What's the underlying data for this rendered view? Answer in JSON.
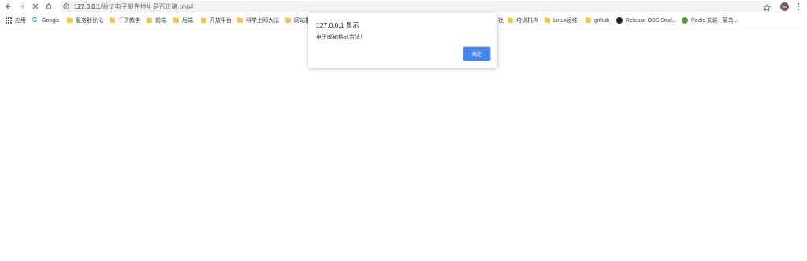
{
  "toolbar": {
    "back_icon": "back-arrow",
    "forward_icon": "forward-arrow",
    "stop_icon": "close-x",
    "home_icon": "home"
  },
  "address_bar": {
    "host": "127.0.0.1",
    "path": "/验证电子邮件地址是否正确.php#"
  },
  "profile": {
    "avatar_text": "ME",
    "avatar_color": "#7a5a4e"
  },
  "bookmarks": [
    {
      "label": "应用",
      "icon": "apps"
    },
    {
      "label": "Google",
      "icon": "google"
    },
    {
      "label": "服务器优化",
      "icon": "folder"
    },
    {
      "label": "干货教学",
      "icon": "folder"
    },
    {
      "label": "前端",
      "icon": "folder"
    },
    {
      "label": "后端",
      "icon": "folder"
    },
    {
      "label": "开放平台",
      "icon": "folder"
    },
    {
      "label": "科学上网大法",
      "icon": "folder"
    },
    {
      "label": "网站推",
      "icon": "folder"
    },
    {
      "label": "社",
      "icon": "none"
    },
    {
      "label": "培训机构",
      "icon": "folder"
    },
    {
      "label": "Linux运维",
      "icon": "folder"
    },
    {
      "label": "github",
      "icon": "folder"
    },
    {
      "label": "Release OBS Stud...",
      "icon": "github"
    },
    {
      "label": "Redis 安装 | 菜鸟...",
      "icon": "redis"
    }
  ],
  "dialog": {
    "title": "127.0.0.1 显示",
    "message": "电子邮箱格式合法！",
    "ok_label": "确定",
    "button_color": "#4285f4"
  }
}
